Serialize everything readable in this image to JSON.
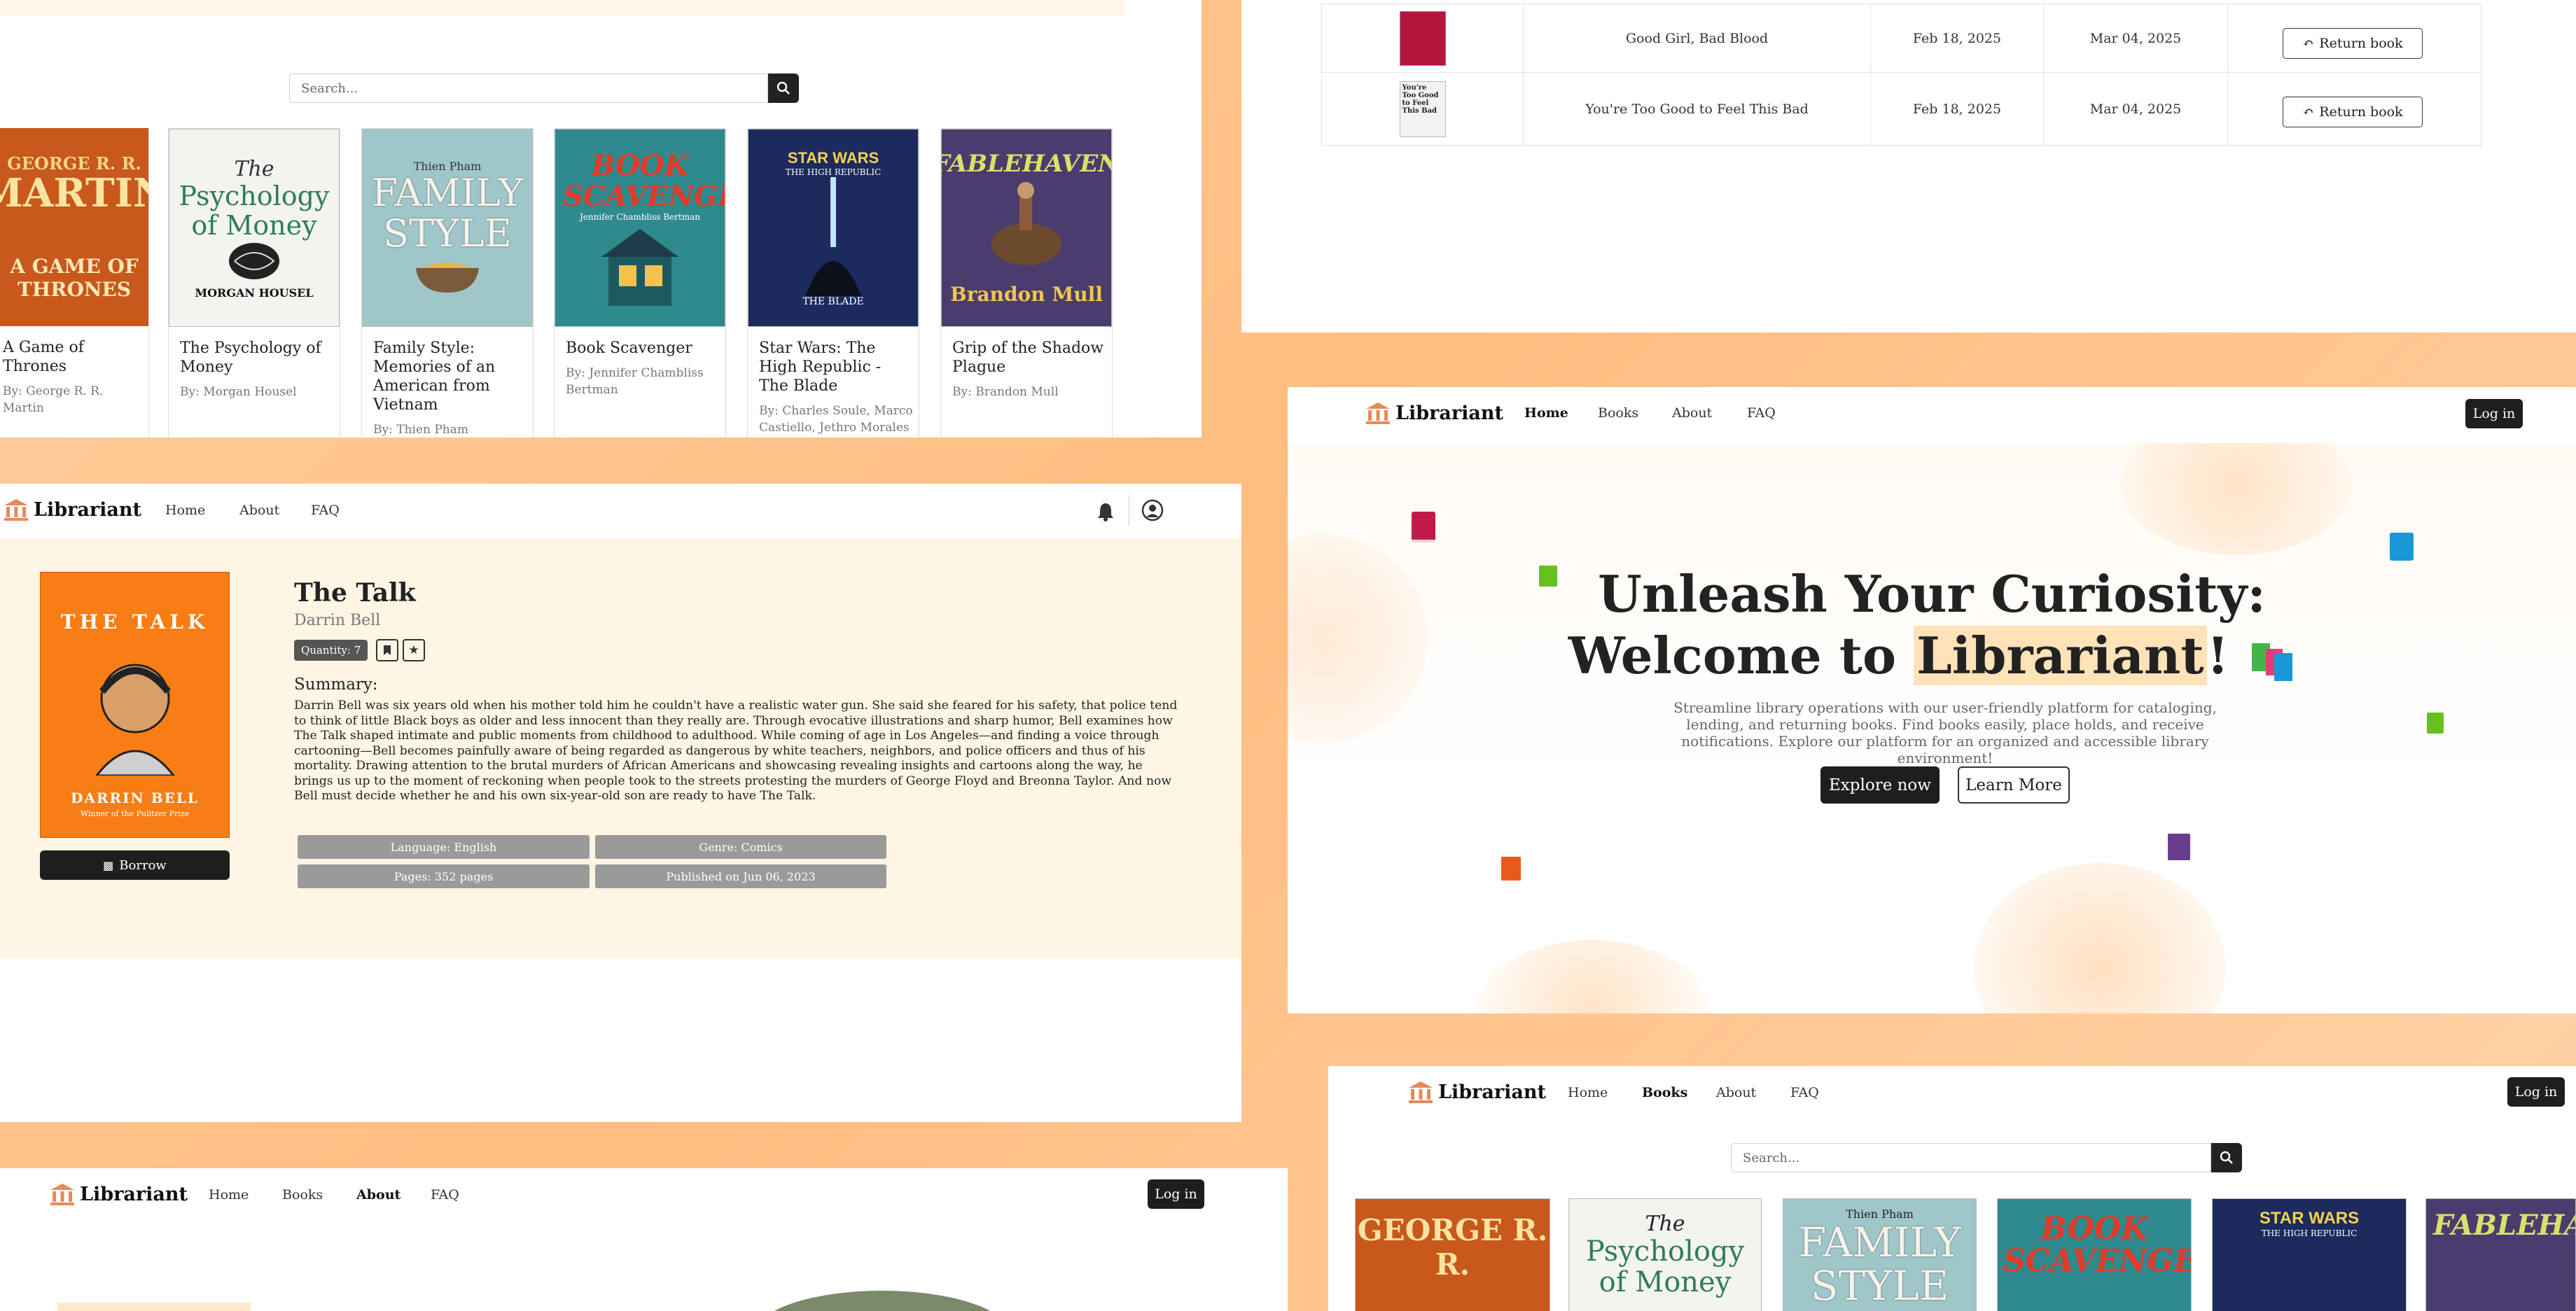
{
  "brand": {
    "name": "Librariant",
    "icon": "library-building-icon"
  },
  "colors": {
    "accent": "#e8895a",
    "dark": "#1e1e1e",
    "cream": "#fff5e4",
    "chip": "#9a9a9a",
    "page_bg": "#ffc896"
  },
  "nav": {
    "home": "Home",
    "books": "Books",
    "about": "About",
    "faq": "FAQ",
    "login": "Log in"
  },
  "search": {
    "placeholder": "Search..."
  },
  "books": [
    {
      "title": "A Game of Thrones",
      "author": "By: George R. R. Martin",
      "cover_top": "GEORGE R. R.",
      "cover_main": "MARTIN",
      "cover_sub": "A GAME OF THRONES",
      "bg": "#c8581c"
    },
    {
      "title": "The Psychology of Money",
      "author": "By: Morgan Housel",
      "cover_top": "The",
      "cover_main": "Psychology of Money",
      "cover_sub": "MORGAN HOUSEL",
      "bg": "#f3f3f0"
    },
    {
      "title": "Family Style: Memories of an American from Vietnam",
      "author": "By: Thien Pham",
      "cover_top": "Thien Pham",
      "cover_main": "FAMILY STYLE",
      "cover_sub": "",
      "bg": "#9fc6c9"
    },
    {
      "title": "Book Scavenger",
      "author": "By: Jennifer Chambliss Bertman",
      "cover_top": "",
      "cover_main": "BOOK SCAVENGER",
      "cover_sub": "Jennifer Chambliss Bertman",
      "bg": "#2f8a8d"
    },
    {
      "title": "Star Wars: The High Republic - The Blade",
      "author": "By: Charles Soule, Marco Castiello, Jethro Morales",
      "cover_top": "STAR WARS",
      "cover_main": "THE HIGH REPUBLIC",
      "cover_sub": "THE BLADE",
      "bg": "#1c2a5e"
    },
    {
      "title": "Grip of the Shadow Plague",
      "author": "By: Brandon Mull",
      "cover_top": "",
      "cover_main": "FABLEHAVEN",
      "cover_sub": "Brandon Mull",
      "bg": "#4b3c6e"
    }
  ],
  "borrowed": {
    "rows": [
      {
        "title": "Good Girl, Bad Blood",
        "borrowed": "Feb 18, 2025",
        "due": "Mar 04, 2025",
        "action": "Return book",
        "thumb": "#b5163c"
      },
      {
        "title": "You're Too Good to Feel This Bad",
        "borrowed": "Feb 18, 2025",
        "due": "Mar 04, 2025",
        "action": "Return book",
        "thumb": "#f2f2f2"
      }
    ],
    "thumb2_text": "You're Too Good to Feel This Bad"
  },
  "detail": {
    "title": "The Talk",
    "author": "Darrin Bell",
    "quantity": "Quantity: 7",
    "summary_heading": "Summary:",
    "summary": "Darrin Bell was six years old when his mother told him he couldn't have a realistic water gun. She said she feared for his safety, that police tend to think of little Black boys as older and less innocent than they really are. Through evocative illustrations and sharp humor, Bell examines how The Talk shaped intimate and public moments from childhood to adulthood. While coming of age in Los Angeles—and finding a voice through cartooning—Bell becomes painfully aware of being regarded as dangerous by white teachers, neighbors, and police officers and thus of his mortality. Drawing attention to the brutal murders of African Americans and showcasing revealing insights and cartoons along the way, he brings us up to the moment of reckoning when people took to the streets protesting the murders of George Floyd and Breonna Taylor. And now Bell must decide whether he and his own six-year-old son are ready to have The Talk.",
    "chips": [
      "Language: English",
      "Genre: Comics",
      "Pages: 352 pages",
      "Published on Jun 06, 2023"
    ],
    "borrow": "Borrow",
    "cover_title": "THE TALK",
    "cover_author": "DARRIN BELL",
    "cover_note": "Winner of the Pulitzer Prize"
  },
  "hero": {
    "line1": "Unleash Your Curiosity:",
    "line2a": "Welcome to ",
    "line2b": "Librariant",
    "line2c": "!",
    "text": "Streamline library operations with our user-friendly platform for cataloging, lending, and returning books. Find books easily, place holds, and receive notifications. Explore our platform for an organized and accessible library environment!",
    "explore": "Explore now",
    "learn": "Learn More"
  }
}
